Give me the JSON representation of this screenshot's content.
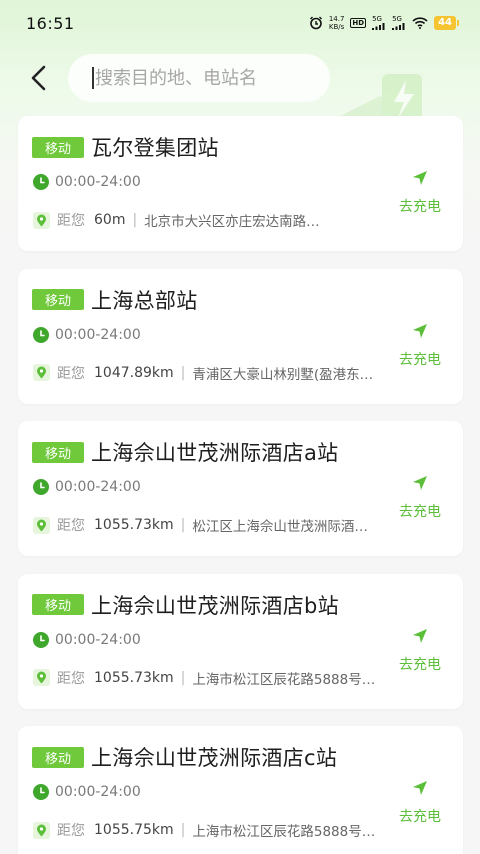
{
  "status_bar": {
    "time": "16:51",
    "net_speed_value": "14.7",
    "net_speed_unit": "KB/s",
    "hd_label": "HD",
    "sig1": "5G",
    "sig2": "5G",
    "battery": "44"
  },
  "search": {
    "placeholder": "搜索目的地、电站名"
  },
  "stations": [
    {
      "operator": "移动",
      "name": "瓦尔登集团站",
      "hours": "00:00-24:00",
      "distance_label": "距您",
      "distance": "60m",
      "address": "北京市大兴区亦庄宏达南路…",
      "action": "去充电"
    },
    {
      "operator": "移动",
      "name": "上海总部站",
      "hours": "00:00-24:00",
      "distance_label": "距您",
      "distance": "1047.89km",
      "address": "青浦区大豪山林别墅(盈港东…",
      "action": "去充电"
    },
    {
      "operator": "移动",
      "name": "上海佘山世茂洲际酒店a站",
      "hours": "00:00-24:00",
      "distance_label": "距您",
      "distance": "1055.73km",
      "address": "松江区上海佘山世茂洲际酒…",
      "action": "去充电"
    },
    {
      "operator": "移动",
      "name": "上海佘山世茂洲际酒店b站",
      "hours": "00:00-24:00",
      "distance_label": "距您",
      "distance": "1055.73km",
      "address": "上海市松江区辰花路5888号…",
      "action": "去充电"
    },
    {
      "operator": "移动",
      "name": "上海佘山世茂洲际酒店c站",
      "hours": "00:00-24:00",
      "distance_label": "距您",
      "distance": "1055.75km",
      "address": "上海市松江区辰花路5888号…",
      "action": "去充电"
    }
  ],
  "colors": {
    "accent": "#6fc93a",
    "accent_text": "#5cbf3a"
  },
  "icons": {
    "back": "chevron-left-icon",
    "clock": "clock-icon",
    "pin": "location-pin-icon",
    "navigate": "navigate-arrow-icon"
  }
}
